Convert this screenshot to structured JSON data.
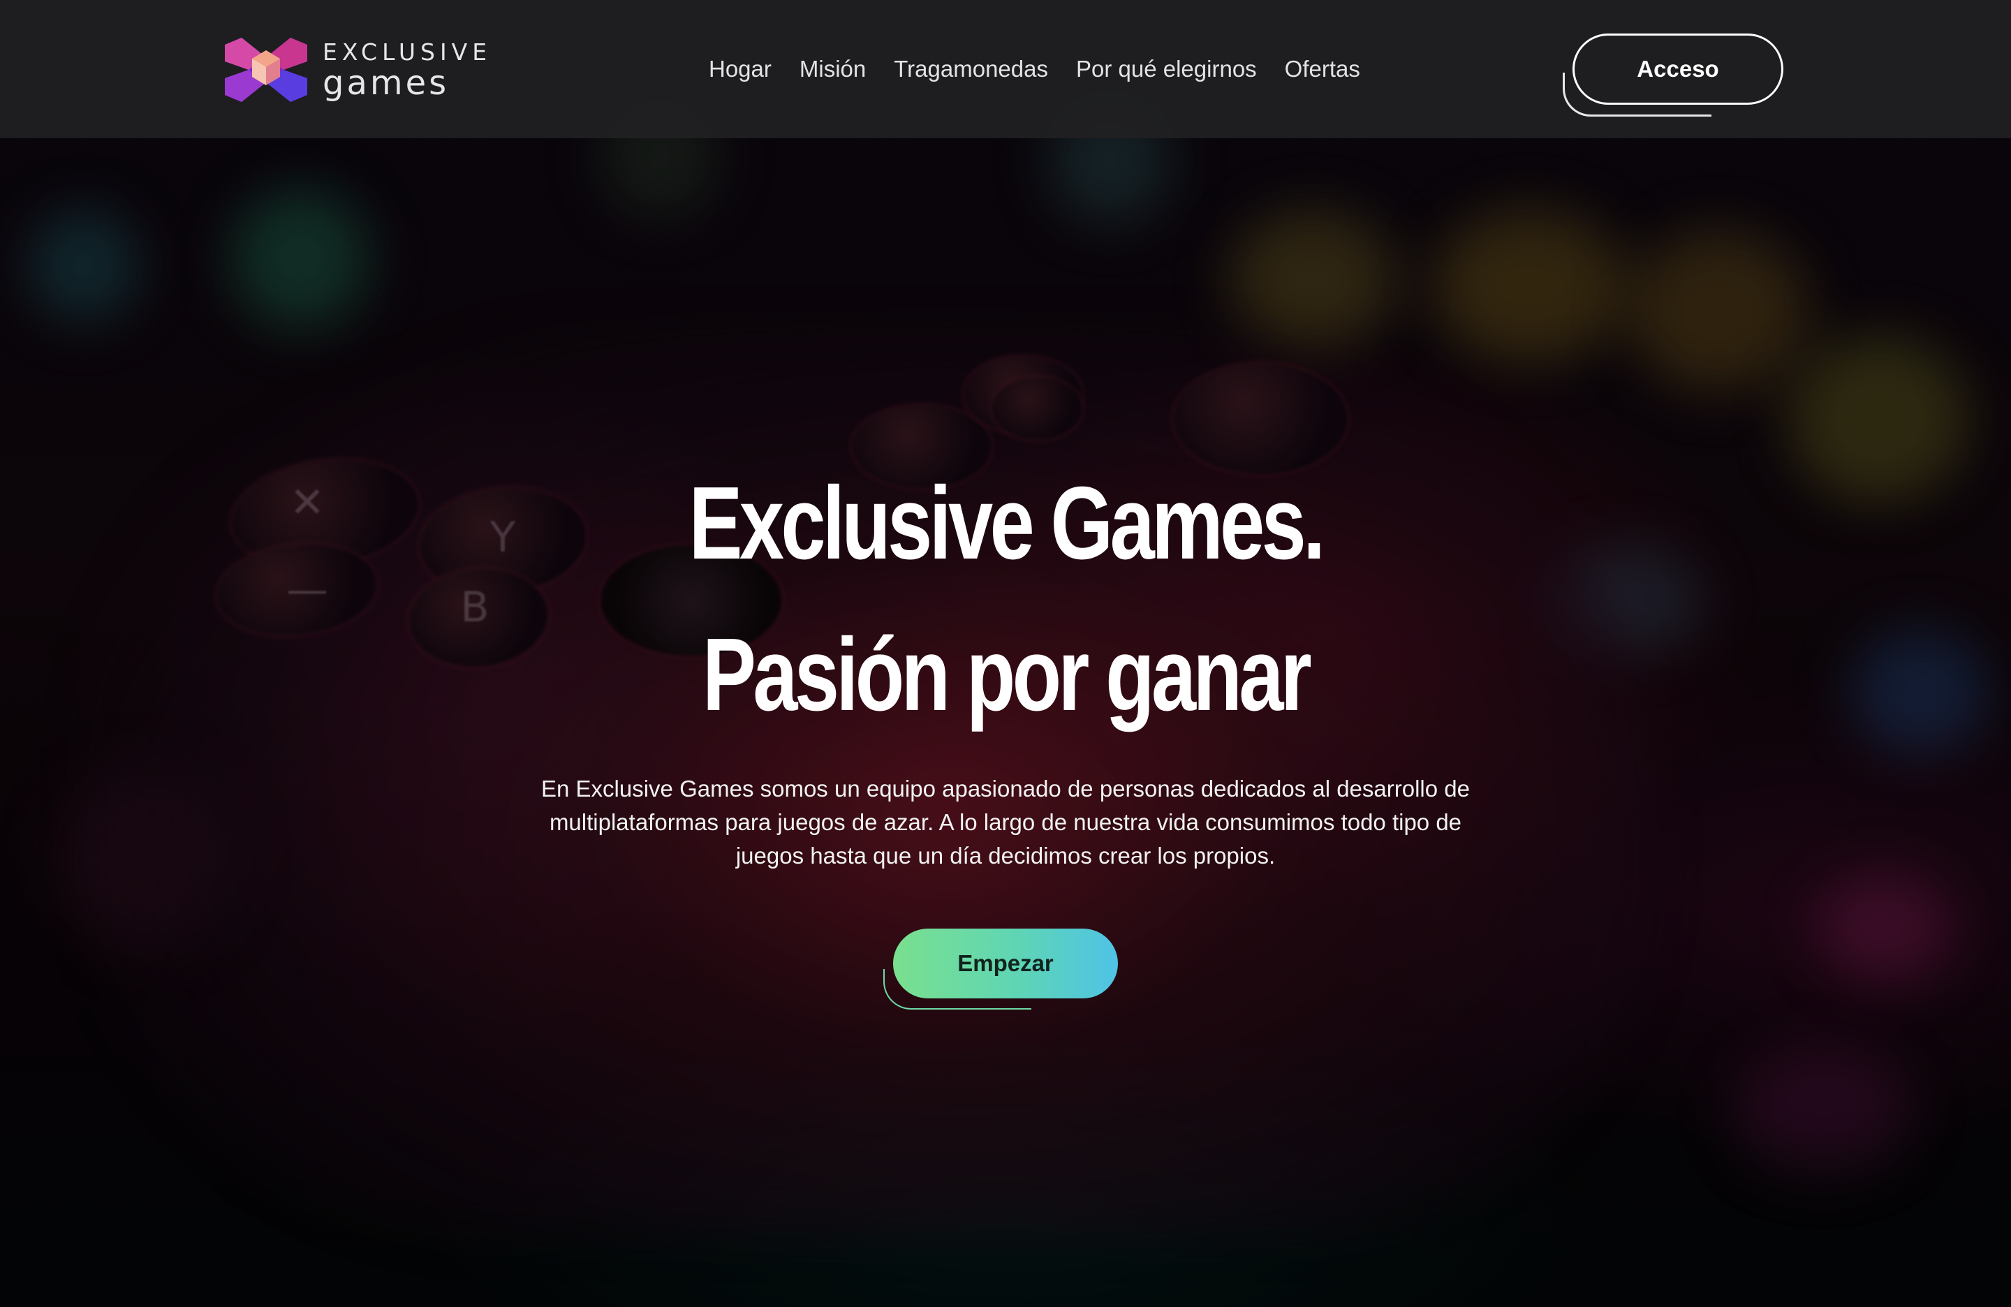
{
  "brand": {
    "line1": "EXCLUSIVE",
    "line2": "games",
    "logo_icon": "pixel-x-logo-icon"
  },
  "nav": {
    "items": [
      {
        "label": "Hogar"
      },
      {
        "label": "Misión"
      },
      {
        "label": "Tragamonedas"
      },
      {
        "label": "Por qué elegirnos"
      },
      {
        "label": "Ofertas"
      }
    ]
  },
  "header": {
    "login_label": "Acceso"
  },
  "hero": {
    "title_line1": "Exclusive Games.",
    "title_line2": "Pasión por ganar",
    "description": "En Exclusive Games somos un equipo apasionado de personas dedicados al desarrollo de multiplataformas para juegos de azar. A lo largo de nuestra vida consumimos todo tipo de juegos hasta que un día decidimos crear los propios.",
    "cta_label": "Empezar",
    "background": "blurred-game-controller-image"
  },
  "colors": {
    "header_bg": "#202022",
    "cta_gradient_start": "#7ae08e",
    "cta_gradient_end": "#4fc3e6",
    "text": "#ffffff"
  }
}
